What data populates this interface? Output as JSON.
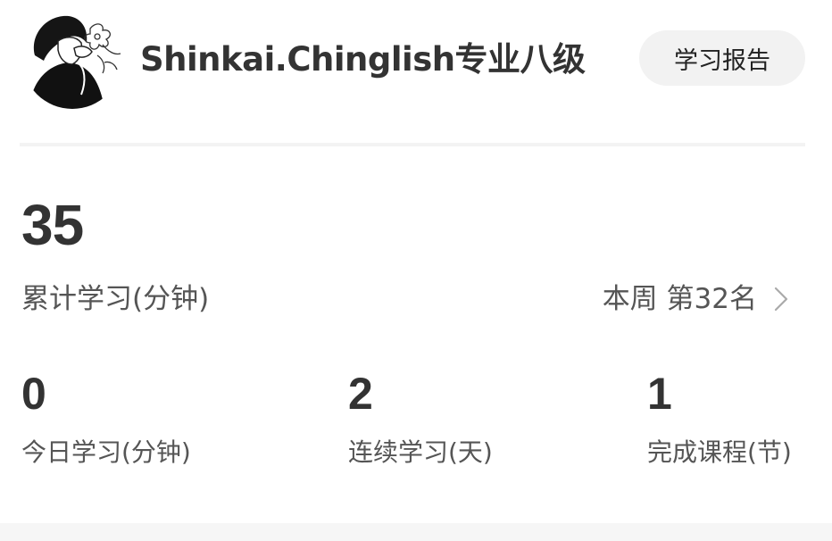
{
  "header": {
    "username": "Shinkai.Chinglish专业八级",
    "report_button_label": "学习报告"
  },
  "total": {
    "value": "35",
    "label": "累计学习(分钟)",
    "rank_text": "本周 第32名"
  },
  "stats": [
    {
      "value": "0",
      "label": "今日学习(分钟)"
    },
    {
      "value": "2",
      "label": "连续学习(天)"
    },
    {
      "value": "1",
      "label": "完成课程(节)"
    }
  ],
  "icons": {
    "rank_arrow": "chevron-right-icon",
    "avatar": "user-avatar"
  },
  "colors": {
    "text_primary": "#333333",
    "text_secondary": "#555555",
    "button_bg": "#f2f2f2",
    "divider": "#f3f3f3"
  }
}
